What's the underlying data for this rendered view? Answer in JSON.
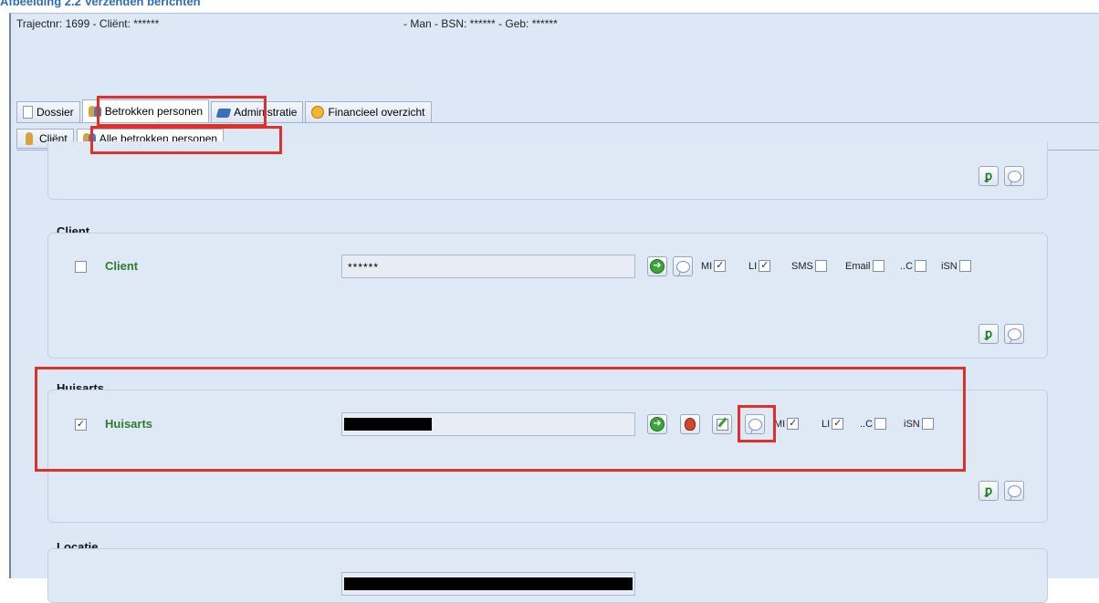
{
  "caption": "Afbeelding 2.2 Verzenden berichten",
  "header": {
    "left": "Trajectnr: 1699 - Cliënt: ******",
    "right": "- Man - BSN: ******   - Geb: ******"
  },
  "tabs": [
    {
      "label": "Dossier",
      "icon": "document-icon"
    },
    {
      "label": "Betrokken personen",
      "icon": "people-icon",
      "active": true
    },
    {
      "label": "Administratie",
      "icon": "book-icon"
    },
    {
      "label": "Financieel overzicht",
      "icon": "coin-icon"
    }
  ],
  "subtabs": [
    {
      "label": "Cliënt",
      "icon": "person-icon"
    },
    {
      "label": "Alle betrokken personen",
      "icon": "people-icon",
      "active": true
    }
  ],
  "sections": {
    "client": {
      "title": "Client",
      "row_label": "Client",
      "checked": false,
      "field_value": "******",
      "options": [
        "MI",
        "LI",
        "SMS",
        "Email",
        "..C",
        "iSN"
      ],
      "options_checked": [
        true,
        true,
        false,
        false,
        false,
        false
      ]
    },
    "huisarts": {
      "title": "Huisarts",
      "row_label": "Huisarts",
      "checked": true,
      "options": [
        "MI",
        "LI",
        "..C",
        "iSN"
      ],
      "options_checked": [
        true,
        true,
        false,
        false
      ]
    },
    "locatie": {
      "title": "Locatie"
    }
  },
  "colors": {
    "highlight": "#e0302a",
    "label_green": "#2e7d2e",
    "panel_bg": "#dfe9f6"
  }
}
